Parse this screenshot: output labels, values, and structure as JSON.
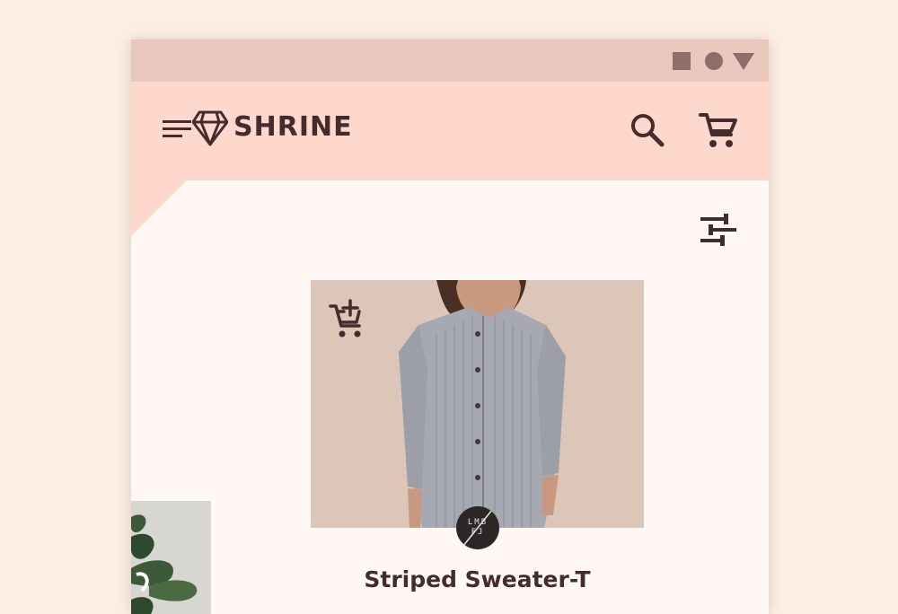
{
  "window_controls": {
    "square_icon": "square-icon",
    "circle_icon": "circle-icon",
    "triangle_icon": "triangle-icon"
  },
  "app_bar": {
    "brand": "SHRINE",
    "menu_icon": "menu-icon",
    "logo_icon": "diamond-icon",
    "search_icon": "search-icon",
    "cart_icon": "shopping-cart-icon",
    "background": "#fed8cc",
    "text_color": "#442c2e"
  },
  "filter": {
    "icon": "tune-icon"
  },
  "product": {
    "name": "Striped Sweater-T",
    "add_to_cart_icon": "add-shopping-cart-icon",
    "vendor_logo_text": "LMB\nFJ"
  },
  "colors": {
    "page_background": "#fdeee4",
    "surface": "#fff8f5",
    "status_bar": "#e9c7bd",
    "status_icons": "#8d6e6a"
  }
}
